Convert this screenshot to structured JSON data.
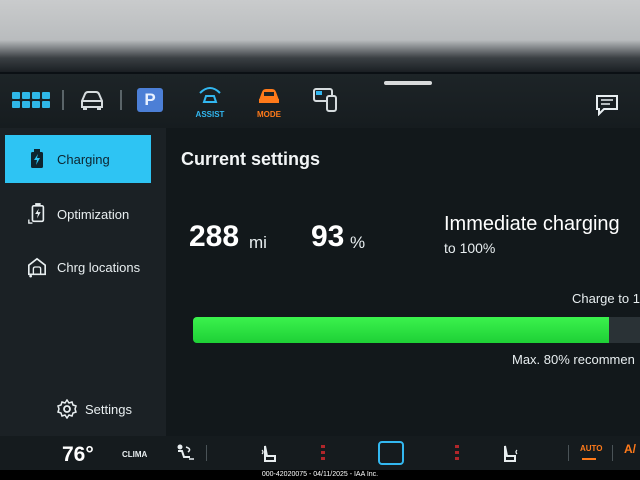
{
  "top_bar": {
    "p_label": "P",
    "assist_label": "ASSIST",
    "mode_label": "MODE"
  },
  "sidebar": {
    "items": [
      {
        "label": "Charging",
        "icon": "battery-charging-icon",
        "active": true
      },
      {
        "label": "Optimization",
        "icon": "optimization-icon",
        "active": false
      },
      {
        "label": "Chrg locations",
        "icon": "charge-locations-icon",
        "active": false
      },
      {
        "label": "Settings",
        "icon": "gear-icon",
        "active": false
      }
    ]
  },
  "main": {
    "title": "Current settings",
    "range_value": "288",
    "range_unit": "mi",
    "battery_value": "93",
    "battery_unit": "%",
    "mode_title": "Immediate charging",
    "mode_sub": "to 100%",
    "charge_to_label": "Charge to 1",
    "charge_level_fraction": 0.93,
    "max_note": "Max. 80% recommen"
  },
  "bottom_bar": {
    "temperature": "76°",
    "clima_label": "CLIMA",
    "auto_label": "AUTO",
    "auto_label_right": "A/"
  },
  "watermark": "000-42020075 - 04/11/2025 - IAA Inc.",
  "colors": {
    "accent": "#2ec4f3",
    "charge_bar": "#2ee843",
    "mode": "#ff7a1a"
  }
}
